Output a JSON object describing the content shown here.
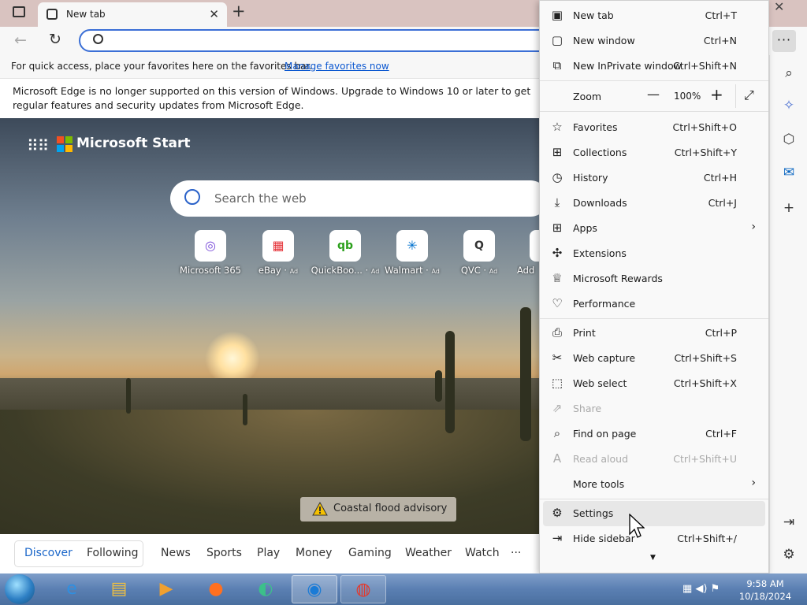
{
  "browser": {
    "tab_title": "New tab",
    "address_value": "",
    "favbar_text": "For quick access, place your favorites here on the favorites bar.",
    "favbar_link": "Manage favorites now",
    "info_text": "Microsoft Edge is no longer supported on this version of Windows. Upgrade to Windows 10 or later to get regular features and security updates from Microsoft Edge."
  },
  "start": {
    "brand": "Microsoft Start",
    "search_placeholder": "Search the web",
    "tiles": [
      {
        "label": "Microsoft 365",
        "ad": "",
        "icon": "microsoft-365-icon"
      },
      {
        "label": "eBay",
        "ad": "Ad",
        "icon": "ebay-icon"
      },
      {
        "label": "QuickBoo...",
        "ad": "Ad",
        "icon": "quickbooks-icon"
      },
      {
        "label": "Walmart",
        "ad": "Ad",
        "icon": "walmart-icon"
      },
      {
        "label": "QVC",
        "ad": "Ad",
        "icon": "qvc-icon"
      },
      {
        "label": "Add",
        "ad": "",
        "icon": "add-icon"
      }
    ],
    "flood_alert": "Coastal flood advisory",
    "nav": [
      "Discover",
      "Following",
      "News",
      "Sports",
      "Play",
      "Money",
      "Gaming",
      "Weather",
      "Watch",
      "···"
    ]
  },
  "menu": {
    "items": [
      {
        "icon": "new-tab-icon",
        "label": "New tab",
        "shortcut": "Ctrl+T"
      },
      {
        "icon": "new-window-icon",
        "label": "New window",
        "shortcut": "Ctrl+N"
      },
      {
        "icon": "inprivate-icon",
        "label": "New InPrivate window",
        "shortcut": "Ctrl+Shift+N"
      },
      {
        "icon": "",
        "label": "Zoom",
        "shortcut": ""
      },
      {
        "icon": "star-icon",
        "label": "Favorites",
        "shortcut": "Ctrl+Shift+O"
      },
      {
        "icon": "collections-icon",
        "label": "Collections",
        "shortcut": "Ctrl+Shift+Y"
      },
      {
        "icon": "history-icon",
        "label": "History",
        "shortcut": "Ctrl+H"
      },
      {
        "icon": "download-icon",
        "label": "Downloads",
        "shortcut": "Ctrl+J"
      },
      {
        "icon": "apps-icon",
        "label": "Apps",
        "shortcut": ""
      },
      {
        "icon": "extensions-icon",
        "label": "Extensions",
        "shortcut": ""
      },
      {
        "icon": "rewards-icon",
        "label": "Microsoft Rewards",
        "shortcut": ""
      },
      {
        "icon": "performance-icon",
        "label": "Performance",
        "shortcut": ""
      },
      {
        "icon": "print-icon",
        "label": "Print",
        "shortcut": "Ctrl+P"
      },
      {
        "icon": "web-capture-icon",
        "label": "Web capture",
        "shortcut": "Ctrl+Shift+S"
      },
      {
        "icon": "web-select-icon",
        "label": "Web select",
        "shortcut": "Ctrl+Shift+X"
      },
      {
        "icon": "share-icon",
        "label": "Share",
        "shortcut": ""
      },
      {
        "icon": "find-icon",
        "label": "Find on page",
        "shortcut": "Ctrl+F"
      },
      {
        "icon": "read-aloud-icon",
        "label": "Read aloud",
        "shortcut": "Ctrl+Shift+U"
      },
      {
        "icon": "",
        "label": "More tools",
        "shortcut": ""
      },
      {
        "icon": "gear-icon",
        "label": "Settings",
        "shortcut": ""
      },
      {
        "icon": "hide-sidebar-icon",
        "label": "Hide sidebar",
        "shortcut": "Ctrl+Shift+/"
      }
    ],
    "zoom_value": "100%",
    "zoom_minus": "—",
    "zoom_plus": "+"
  },
  "taskbar": {
    "time": "9:58 AM",
    "date": "10/18/2024"
  }
}
